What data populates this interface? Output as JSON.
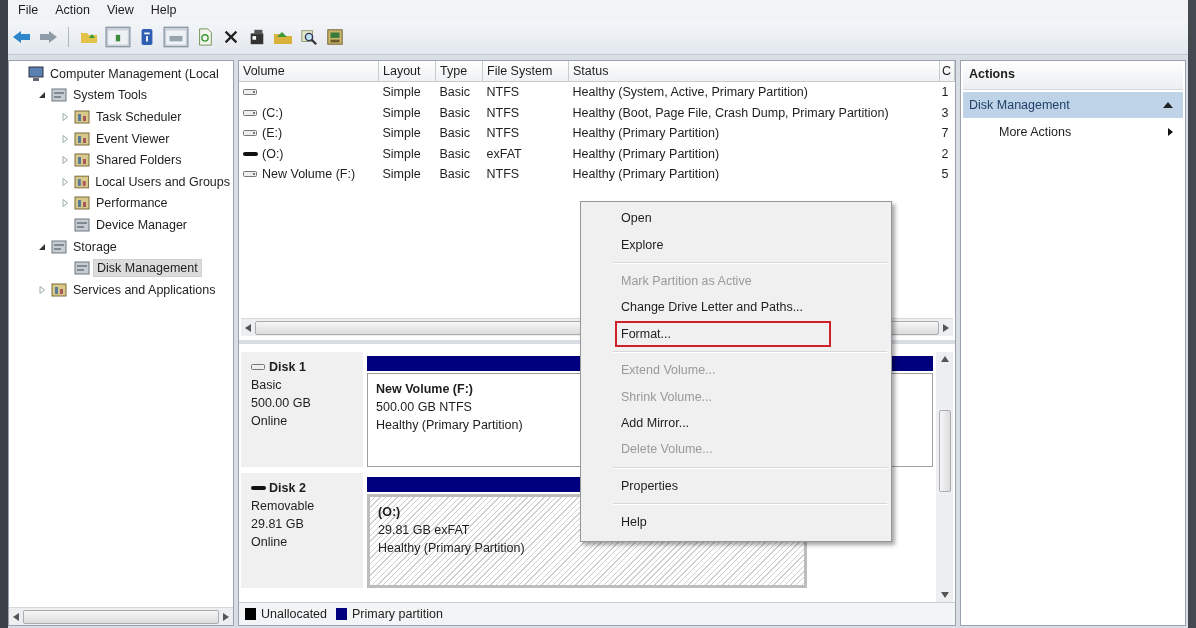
{
  "menu_bar": [
    "File",
    "Action",
    "View",
    "Help"
  ],
  "tree": [
    {
      "label": "Computer Management (Local",
      "selected": false,
      "children": [
        {
          "label": "System Tools",
          "selected": false,
          "expanded": true,
          "children": [
            {
              "label": "Task Scheduler",
              "selected": false,
              "expanded": false
            },
            {
              "label": "Event Viewer",
              "selected": false,
              "expanded": false
            },
            {
              "label": "Shared Folders",
              "selected": false,
              "expanded": false
            },
            {
              "label": "Local Users and Groups",
              "selected": false,
              "expanded": false
            },
            {
              "label": "Performance",
              "selected": false,
              "expanded": false
            },
            {
              "label": "Device Manager",
              "selected": false
            }
          ]
        },
        {
          "label": "Storage",
          "selected": false,
          "expanded": true,
          "children": [
            {
              "label": "Disk Management",
              "selected": true
            }
          ]
        },
        {
          "label": "Services and Applications",
          "selected": false,
          "expanded": false
        }
      ]
    }
  ],
  "volume_table": {
    "columns": [
      "Volume",
      "Layout",
      "Type",
      "File System",
      "Status",
      "C"
    ],
    "rows": [
      {
        "kind": "disk",
        "layout": "Simple",
        "type": "Basic",
        "file_system": "NTFS",
        "status": "Healthy (System, Active, Primary Partition)",
        "column_6": "1"
      },
      {
        "kind": "disk",
        "volume": "(C:)",
        "layout": "Simple",
        "type": "Basic",
        "file_system": "NTFS",
        "status": "Healthy (Boot, Page File, Crash Dump, Primary Partition)",
        "column_6": "3"
      },
      {
        "kind": "disk",
        "volume": "(E:)",
        "layout": "Simple",
        "type": "Basic",
        "file_system": "NTFS",
        "status": "Healthy (Primary Partition)",
        "column_6": "7"
      },
      {
        "kind": "removable",
        "volume": "(O:)",
        "layout": "Simple",
        "type": "Basic",
        "file_system": "exFAT",
        "status": "Healthy (Primary Partition)",
        "column_6": "2"
      },
      {
        "kind": "disk",
        "volume": "New Volume (F:)",
        "layout": "Simple",
        "type": "Basic",
        "file_system": "NTFS",
        "status": "Healthy (Primary Partition)",
        "column_6": "5"
      }
    ]
  },
  "disks": [
    {
      "kind": "disk",
      "name": "Disk 1",
      "type": "Basic",
      "size": "500.00 GB",
      "status": "Online",
      "partition": {
        "name": "New Volume  (F:)",
        "detail": "500.00 GB NTFS",
        "health": "Healthy (Primary Partition)",
        "selected": false
      }
    },
    {
      "kind": "removable",
      "name": "Disk 2",
      "type": "Removable",
      "size": "29.81 GB",
      "status": "Online",
      "partition": {
        "name": "(O:)",
        "detail": "29.81 GB exFAT",
        "health": "Healthy (Primary Partition)",
        "selected": true
      }
    }
  ],
  "legend": [
    {
      "label": "Unallocated",
      "color": "#000000"
    },
    {
      "label": "Primary partition",
      "color": "#00007f"
    }
  ],
  "context_menu": [
    {
      "kind": "item",
      "label": "Open",
      "disabled": false,
      "highlighted": false
    },
    {
      "kind": "item",
      "label": "Explore",
      "disabled": false,
      "highlighted": false
    },
    {
      "kind": "separator"
    },
    {
      "kind": "item",
      "label": "Mark Partition as Active",
      "disabled": true,
      "highlighted": false
    },
    {
      "kind": "item",
      "label": "Change Drive Letter and Paths...",
      "disabled": false,
      "highlighted": false
    },
    {
      "kind": "item",
      "label": "Format...",
      "disabled": false,
      "highlighted": true
    },
    {
      "kind": "separator"
    },
    {
      "kind": "item",
      "label": "Extend Volume...",
      "disabled": true,
      "highlighted": false
    },
    {
      "kind": "item",
      "label": "Shrink Volume...",
      "disabled": true,
      "highlighted": false
    },
    {
      "kind": "item",
      "label": "Add Mirror...",
      "disabled": false,
      "highlighted": false
    },
    {
      "kind": "item",
      "label": "Delete Volume...",
      "disabled": true,
      "highlighted": false
    },
    {
      "kind": "separator"
    },
    {
      "kind": "item",
      "label": "Properties",
      "disabled": false,
      "highlighted": false
    },
    {
      "kind": "separator"
    },
    {
      "kind": "item",
      "label": "Help",
      "disabled": false,
      "highlighted": false
    }
  ],
  "actions": {
    "title": "Actions",
    "section": {
      "label": "Disk Management",
      "expanded": true
    },
    "items": [
      "More Actions"
    ]
  }
}
